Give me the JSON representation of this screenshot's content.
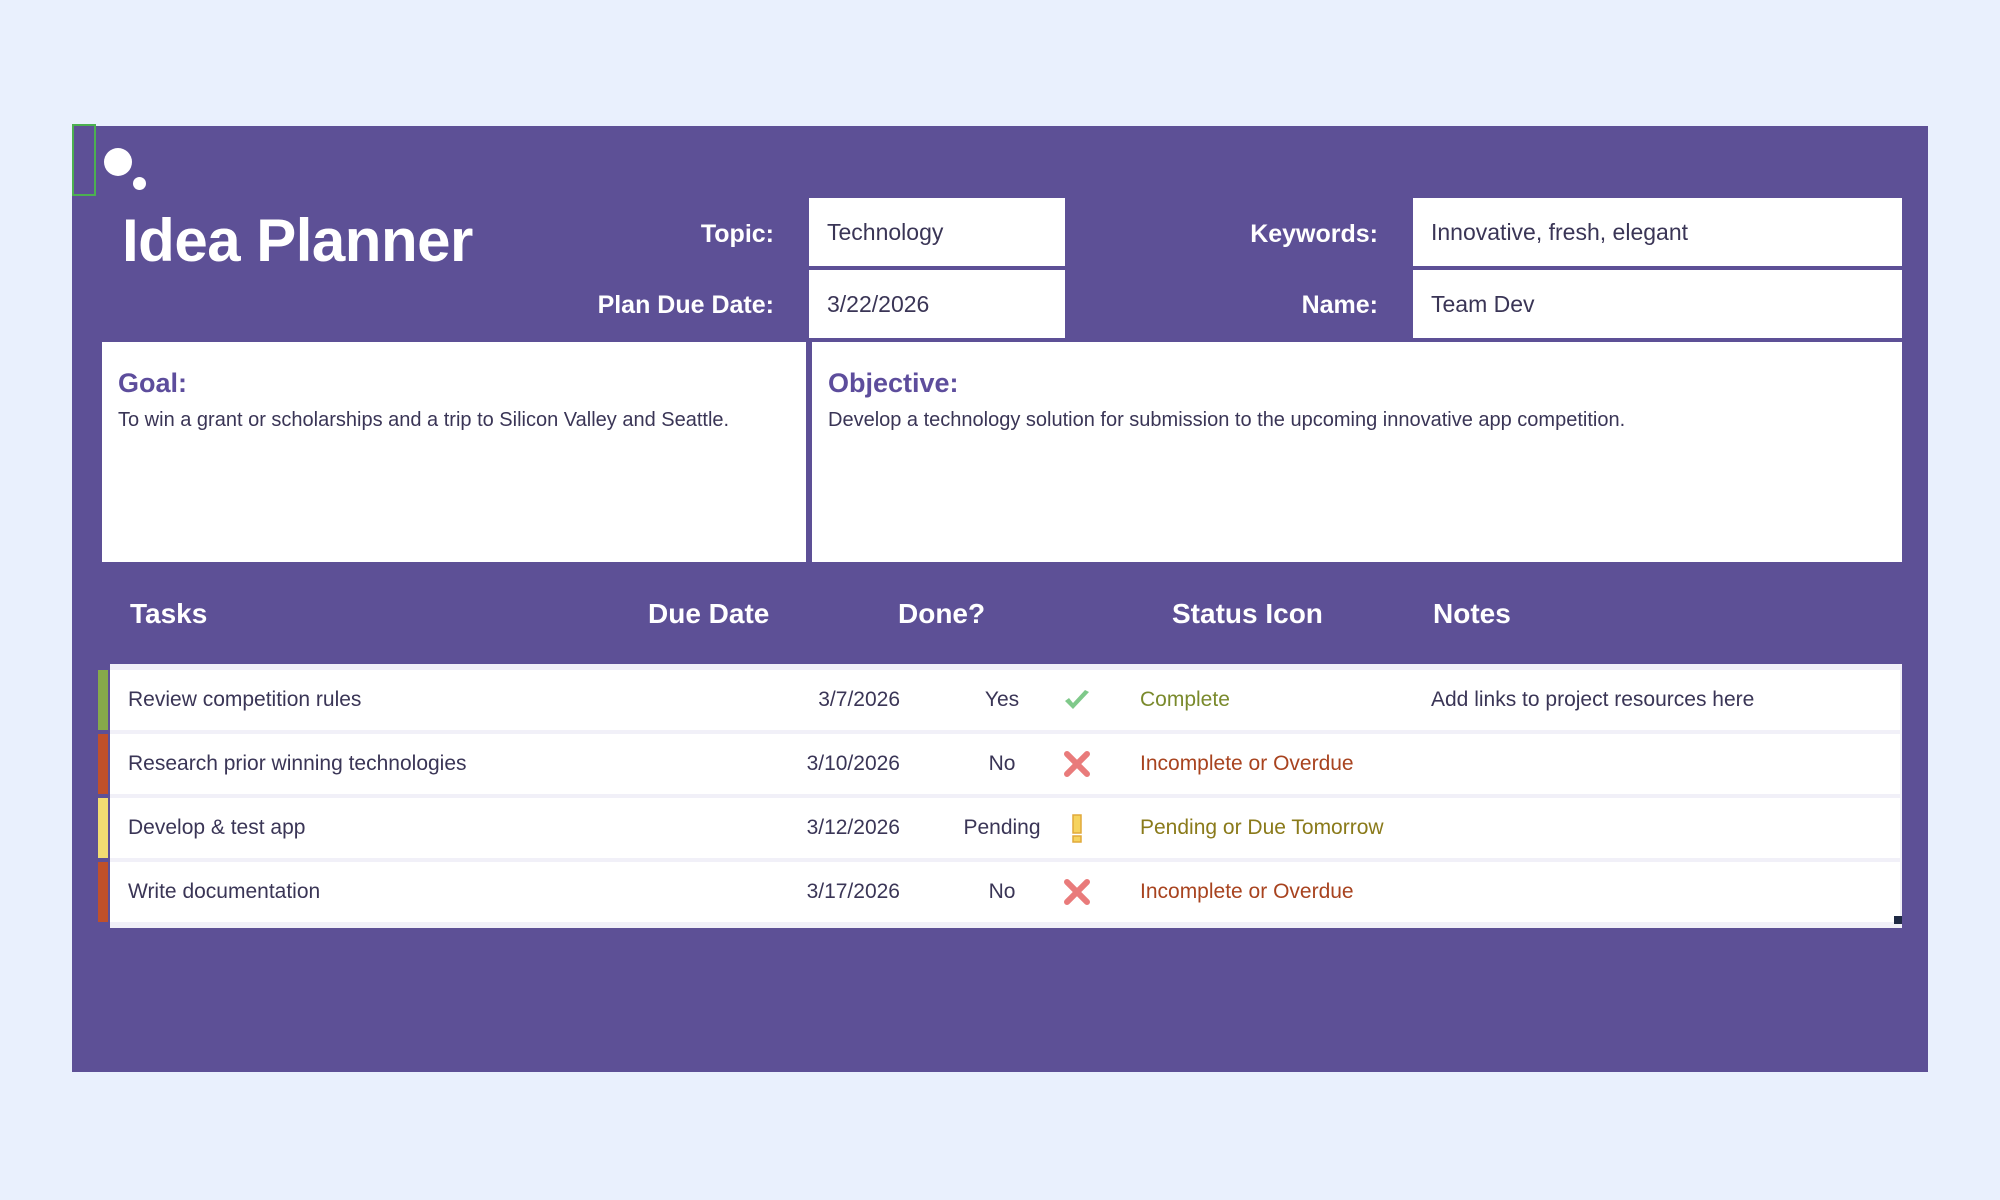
{
  "app": {
    "title": "Idea Planner"
  },
  "header": {
    "topic_label": "Topic:",
    "topic_value": "Technology",
    "due_label": "Plan Due Date:",
    "due_value": "3/22/2026",
    "keywords_label": "Keywords:",
    "keywords_value": "Innovative, fresh, elegant",
    "name_label": "Name:",
    "name_value": "Team Dev"
  },
  "goal": {
    "heading": "Goal:",
    "text": "To win a grant or scholarships and a trip to Silicon Valley and Seattle."
  },
  "objective": {
    "heading": "Objective:",
    "text": "Develop a technology solution for submission to the upcoming innovative app competition."
  },
  "table": {
    "headers": [
      "Tasks",
      "Due Date",
      "Done?",
      "Status Icon",
      "Notes"
    ],
    "rows": [
      {
        "task": "Review competition rules",
        "due": "3/7/2026",
        "done": "Yes",
        "icon": "check-icon",
        "status": "Complete",
        "notes": "Add links to project resources here"
      },
      {
        "task": "Research prior winning technologies",
        "due": "3/10/2026",
        "done": "No",
        "icon": "x-icon",
        "status": "Incomplete or Overdue",
        "notes": ""
      },
      {
        "task": "Develop & test app",
        "due": "3/12/2026",
        "done": "Pending",
        "icon": "exclamation-icon",
        "status": "Pending or Due Tomorrow",
        "notes": ""
      },
      {
        "task": "Write documentation",
        "due": "3/17/2026",
        "done": "No",
        "icon": "x-icon",
        "status": "Incomplete or Overdue",
        "notes": ""
      }
    ]
  },
  "colors": {
    "background": "#e9f0fd",
    "sheet": "#5d5096",
    "complete": "#7a8a2c",
    "incomplete": "#a8431f",
    "pending": "#8a7a1a",
    "bar_green": "#86a94a",
    "bar_red": "#c0502a",
    "bar_yellow": "#f2dc72"
  }
}
